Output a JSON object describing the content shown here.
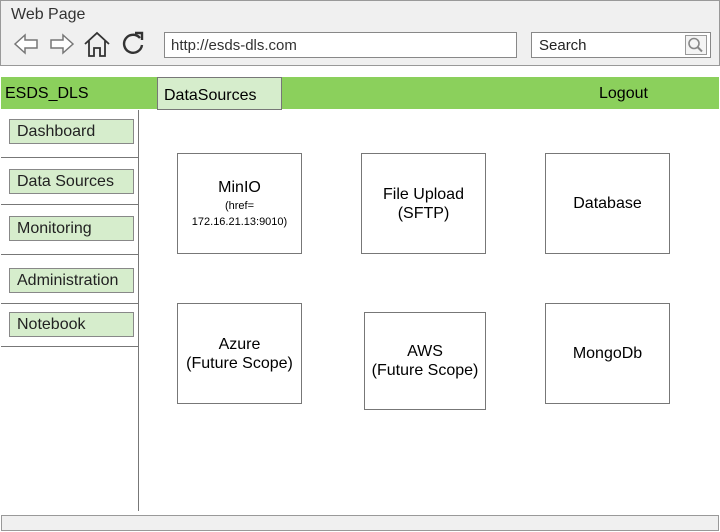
{
  "browser": {
    "window_title": "Web Page",
    "url": "http://esds-dls.com",
    "search_label": "Search"
  },
  "header": {
    "brand": "ESDS_DLS",
    "active_tab": "DataSources",
    "logout": "Logout"
  },
  "sidebar": {
    "items": [
      {
        "label": "Dashboard"
      },
      {
        "label": "Data Sources"
      },
      {
        "label": "Monitoring"
      },
      {
        "label": "Administration"
      },
      {
        "label": "Notebook"
      }
    ]
  },
  "sources": {
    "minio": {
      "title": "MinIO",
      "sub_line1": "(href=",
      "sub_line2": "172.16.21.13:9010)"
    },
    "file_upload": {
      "line1": "File Upload",
      "line2": "(SFTP)"
    },
    "database": {
      "title": "Database"
    },
    "azure": {
      "line1": "Azure",
      "line2": "(Future Scope)"
    },
    "aws": {
      "line1": "AWS",
      "line2": "(Future Scope)"
    },
    "mongodb": {
      "title": "MongoDb"
    }
  },
  "icons": {
    "back": "back-arrow-icon",
    "forward": "forward-arrow-icon",
    "home": "home-icon",
    "reload": "reload-icon",
    "search": "magnifier-icon"
  },
  "colors": {
    "header_green": "#8bd05c",
    "button_green": "#d6edcc",
    "chrome_gray": "#f0f0f0"
  }
}
